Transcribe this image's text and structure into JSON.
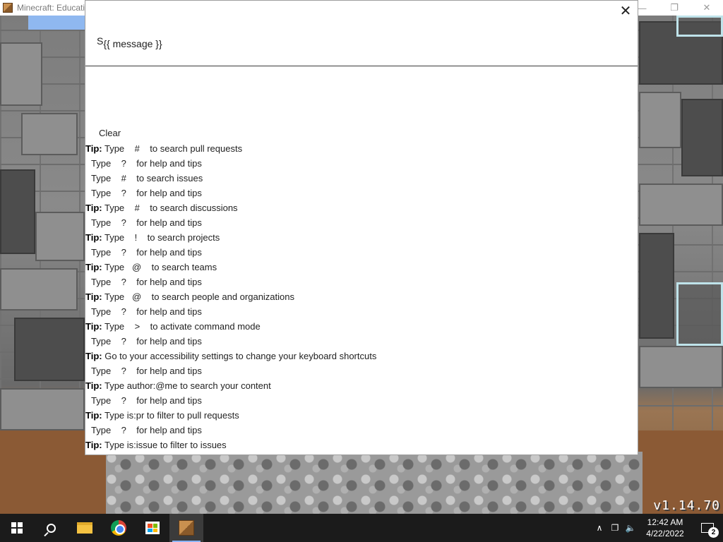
{
  "host_window": {
    "title": "Minecraft: Educati",
    "minimize_glyph": "—",
    "restore_glyph": "❐",
    "close_glyph": "✕"
  },
  "overlay": {
    "close_glyph": "✕",
    "message_prefix": "S",
    "message_text": "{{ message }}",
    "clear_label": "Clear",
    "tips": [
      {
        "bold": "Tip:",
        "text": " Type    #    to search pull requests"
      },
      {
        "bold": "",
        "text": "Type    ?    for help and tips"
      },
      {
        "bold": "",
        "text": "Type    #    to search issues"
      },
      {
        "bold": "",
        "text": "Type    ?    for help and tips"
      },
      {
        "bold": "Tip:",
        "text": " Type    #    to search discussions"
      },
      {
        "bold": "",
        "text": "Type    ?    for help and tips"
      },
      {
        "bold": "Tip:",
        "text": " Type    !    to search projects"
      },
      {
        "bold": "",
        "text": "Type    ?    for help and tips"
      },
      {
        "bold": "Tip:",
        "text": " Type   @    to search teams"
      },
      {
        "bold": "",
        "text": "Type    ?    for help and tips"
      },
      {
        "bold": "Tip:",
        "text": " Type   @    to search people and organizations"
      },
      {
        "bold": "",
        "text": "Type    ?    for help and tips"
      },
      {
        "bold": "Tip:",
        "text": " Type    >    to activate command mode"
      },
      {
        "bold": "",
        "text": "Type    ?    for help and tips"
      },
      {
        "bold": "Tip:",
        "text": " Go to your accessibility settings to change your keyboard shortcuts"
      },
      {
        "bold": "",
        "text": "Type    ?    for help and tips"
      },
      {
        "bold": "Tip:",
        "text": " Type author:@me to search your content"
      },
      {
        "bold": "",
        "text": "Type    ?    for help and tips"
      },
      {
        "bold": "Tip:",
        "text": " Type is:pr to filter to pull requests"
      },
      {
        "bold": "",
        "text": "Type    ?    for help and tips"
      },
      {
        "bold": "Tip:",
        "text": " Type is:issue to filter to issues"
      }
    ]
  },
  "watermark": {
    "version": "v1.14.70"
  },
  "taskbar": {
    "items": [
      {
        "name": "start-button",
        "icon": "windows-icon"
      },
      {
        "name": "search-button",
        "icon": "search-icon"
      },
      {
        "name": "file-explorer-button",
        "icon": "folder-icon"
      },
      {
        "name": "chrome-button",
        "icon": "chrome-icon"
      },
      {
        "name": "store-button",
        "icon": "store-icon"
      },
      {
        "name": "minecraft-button",
        "icon": "minecraft-icon"
      }
    ],
    "tray": {
      "chevron_glyph": "∧",
      "network_glyph": "❐",
      "volume_glyph": "🔈",
      "time": "12:42 AM",
      "date": "4/22/2022",
      "notification_count": "2"
    }
  },
  "colors": {
    "overlay_bg": "#ffffff",
    "taskbar_bg": "#1b1b1b",
    "accent": "#8ab4f8"
  }
}
